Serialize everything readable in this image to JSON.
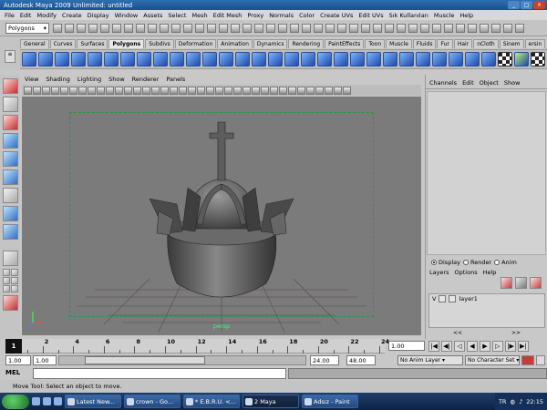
{
  "window": {
    "title": "Autodesk Maya 2009 Unlimited: untitled"
  },
  "menubar": [
    "File",
    "Edit",
    "Modify",
    "Create",
    "Display",
    "Window",
    "Assets",
    "Select",
    "Mesh",
    "Edit Mesh",
    "Proxy",
    "Normals",
    "Color",
    "Create UVs",
    "Edit UVs",
    "Sık Kullanılan",
    "Muscle",
    "Help"
  ],
  "status_line": {
    "mode": "Polygons"
  },
  "shelf_tabs": [
    "General",
    "Curves",
    "Surfaces",
    "Polygons",
    "Subdivs",
    "Deformation",
    "Animation",
    "Dynamics",
    "Rendering",
    "PaintEffects",
    "Toon",
    "Muscle",
    "Fluids",
    "Fur",
    "Hair",
    "nCloth",
    "Sinem",
    "ersin"
  ],
  "active_shelf": "Polygons",
  "panel_menu": [
    "View",
    "Shading",
    "Lighting",
    "Show",
    "Renderer",
    "Panels"
  ],
  "viewport": {
    "camera_name": "persp"
  },
  "channel_box": {
    "menu": [
      "Channels",
      "Edit",
      "Object",
      "Show"
    ]
  },
  "layer_editor": {
    "modes": [
      "Display",
      "Render",
      "Anim"
    ],
    "selected_mode": "Display",
    "menu": [
      "Layers",
      "Options",
      "Help"
    ],
    "layers": [
      {
        "v": "V",
        "name": "layer1"
      }
    ]
  },
  "time_slider": {
    "current_frame": "1",
    "current_field": "1.00",
    "ticks": [
      "2",
      "4",
      "6",
      "8",
      "10",
      "12",
      "14",
      "16",
      "18",
      "20",
      "22",
      "24"
    ]
  },
  "range_slider": {
    "start_time": "1.00",
    "playback_start": "1.00",
    "playback_end": "24.00",
    "end_time": "48.00",
    "anim_layer": "No Anim Layer",
    "character_set": "No Character Set"
  },
  "command_line": {
    "label": "MEL"
  },
  "help_line": {
    "text": "Move Tool: Select an object to move."
  },
  "taskbar": {
    "tasks": [
      {
        "label": "Latest New..."
      },
      {
        "label": "crown - Go..."
      },
      {
        "label": "* E.B.R.U. <..."
      },
      {
        "label": "2 Maya"
      },
      {
        "label": "Adsız - Paint"
      }
    ],
    "active_task": 3,
    "tray": {
      "language": "TR",
      "time": "22:15"
    }
  }
}
